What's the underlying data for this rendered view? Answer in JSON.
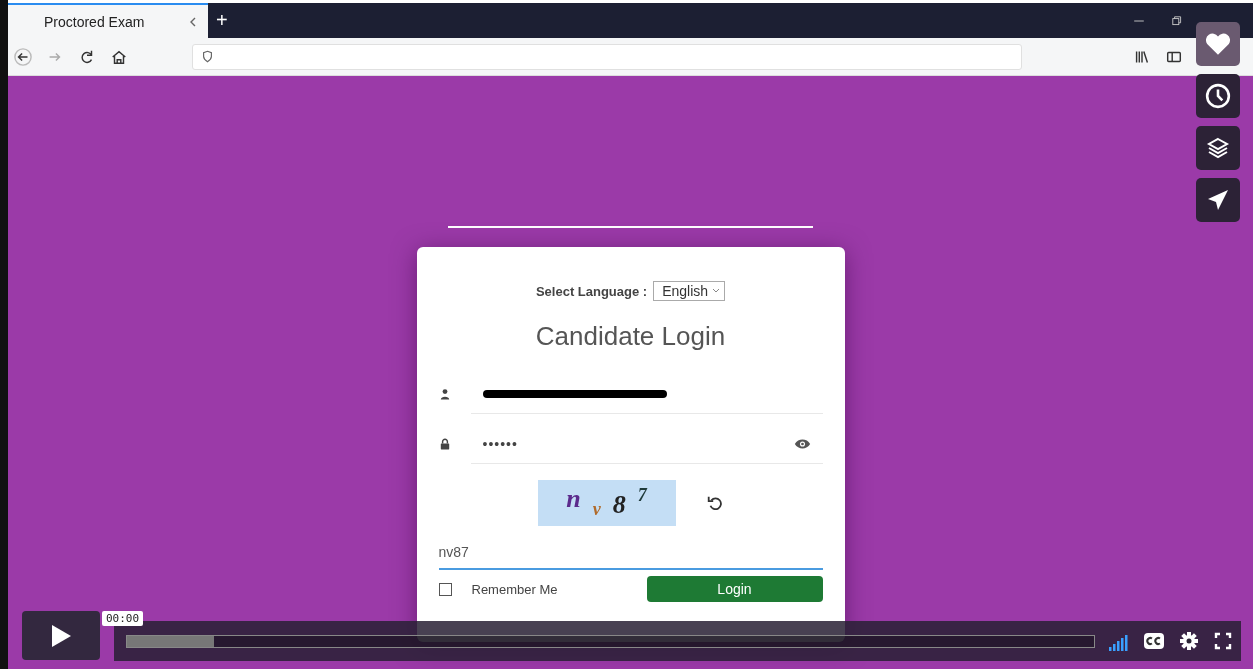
{
  "browser": {
    "tab": {
      "title": "Proctored Exam",
      "selected": true
    },
    "new_tab": "+"
  },
  "login": {
    "language_label": "Select Language :",
    "language": "English",
    "title": "Candidate Login",
    "username": {
      "redacted": true
    },
    "password": {
      "value": "••••••"
    },
    "captcha": {
      "characters": [
        {
          "char": "n",
          "color": "#5b2a8c"
        },
        {
          "char": "v",
          "color": "#b06a2a"
        },
        {
          "char": "8",
          "color": "#222222"
        },
        {
          "char": "7",
          "color": "#1f3a3a"
        }
      ]
    },
    "captcha_answer": {
      "value": "nv87"
    },
    "remember": {
      "label": "Remember Me",
      "checked": false
    },
    "login_button": "Login"
  },
  "player": {
    "time": "00:00",
    "progress": {
      "level": 0.09
    },
    "captions_on": false
  }
}
